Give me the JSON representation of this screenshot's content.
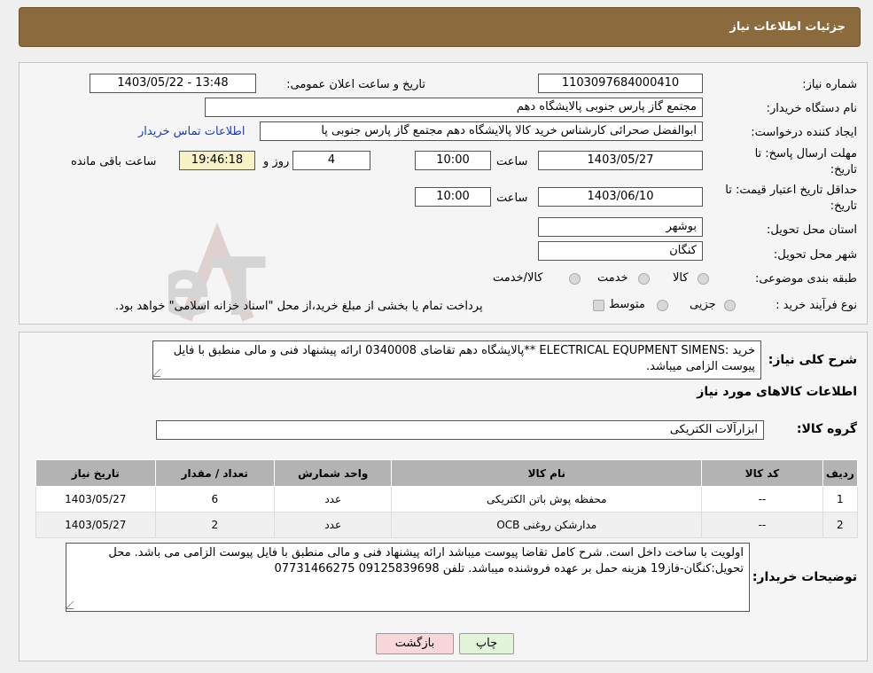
{
  "header": {
    "title": "جزئیات اطلاعات نیاز"
  },
  "form": {
    "need_number_label": "شماره نیاز:",
    "need_number": "1103097684000410",
    "announce_label": "تاریخ و ساعت اعلان عمومی:",
    "announce_value": "1403/05/22 - 13:48",
    "buyer_org_label": "نام دستگاه خریدار:",
    "buyer_org": "مجتمع گاز پارس جنوبی  پالایشگاه دهم",
    "creator_label": "ایجاد کننده درخواست:",
    "creator": "ابوالفضل صحرائی کارشناس خرید کالا پالایشگاه دهم مجتمع گاز پارس جنوبی  پا",
    "contact_link": "اطلاعات تماس خریدار",
    "deadline_label_1": "مهلت ارسال پاسخ: تا",
    "deadline_label_2": "تاریخ:",
    "deadline_date": "1403/05/27",
    "time_label": "ساعت",
    "deadline_time": "10:00",
    "days_value": "4",
    "days_label": "روز و",
    "remaining_time": "19:46:18",
    "remaining_label": "ساعت باقی مانده",
    "validity_label_1": "حداقل تاریخ اعتبار قیمت: تا",
    "validity_label_2": "تاریخ:",
    "validity_date": "1403/06/10",
    "validity_time": "10:00",
    "province_label": "استان محل تحویل:",
    "province": "بوشهر",
    "city_label": "شهر محل تحویل:",
    "city": "کنگان",
    "category_label": "طبقه بندی موضوعی:",
    "category_options": [
      "کالا",
      "خدمت",
      "کالا/خدمت"
    ],
    "process_label": "نوع فرآیند خرید :",
    "process_options": [
      "جزیی",
      "متوسط"
    ],
    "process_note": "پرداخت تمام یا بخشی از مبلغ خرید،از محل \"اسناد خزانه اسلامی\" خواهد بود."
  },
  "summary": {
    "label": "شرح کلی نیاز:",
    "text": "خرید :ELECTRICAL EQUPMENT SIMENS **پالایشگاه دهم تقاضای 0340008  ارائه پیشنهاد فنی و مالی منطبق با فایل پیوست الزامی میباشد."
  },
  "goods_section_title": "اطلاعات کالاهای مورد نیاز",
  "goods_group_label": "گروه کالا:",
  "goods_group": "ابزارآلات الکتریکی",
  "table": {
    "headers": [
      "ردیف",
      "کد کالا",
      "نام کالا",
      "واحد شمارش",
      "تعداد / مقدار",
      "تاریخ نیاز"
    ],
    "rows": [
      [
        "1",
        "--",
        "محفظه پوش باتن الکتریکی",
        "عدد",
        "6",
        "1403/05/27"
      ],
      [
        "2",
        "--",
        "مدارشکن روغنی OCB",
        "عدد",
        "2",
        "1403/05/27"
      ]
    ]
  },
  "buyer_notes": {
    "label": "توضیحات خریدار:",
    "text": "اولویت با ساخت داخل است. شرح کامل تقاضا پیوست میباشد ارائه پیشنهاد فنی و مالی منطبق با فایل پیوست الزامی می باشد. محل تحویل:کنگان-فاز19 هزینه حمل بر عهده فروشنده میباشد. تلفن 09125839698  07731466275"
  },
  "buttons": {
    "print": "چاپ",
    "back": "بازگشت"
  },
  "watermark": "AriaTender.neT",
  "colors": {
    "header": "#8b6a3d",
    "table_header": "#b3b3b3",
    "back_button": "#f7d7d7",
    "print_button": "#e3f5d9"
  }
}
